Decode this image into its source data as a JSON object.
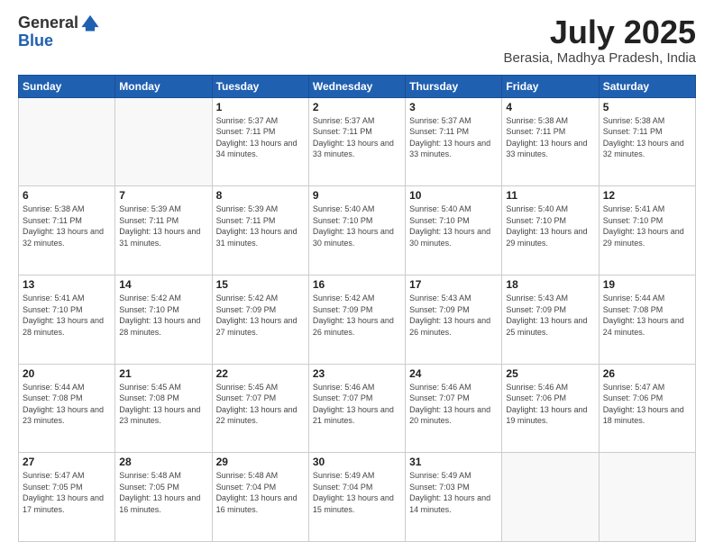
{
  "header": {
    "logo_general": "General",
    "logo_blue": "Blue",
    "title_month": "July 2025",
    "title_location": "Berasia, Madhya Pradesh, India"
  },
  "days_of_week": [
    "Sunday",
    "Monday",
    "Tuesday",
    "Wednesday",
    "Thursday",
    "Friday",
    "Saturday"
  ],
  "weeks": [
    [
      {
        "day": null,
        "info": ""
      },
      {
        "day": null,
        "info": ""
      },
      {
        "day": "1",
        "sunrise": "5:37 AM",
        "sunset": "7:11 PM",
        "daylight": "13 hours and 34 minutes."
      },
      {
        "day": "2",
        "sunrise": "5:37 AM",
        "sunset": "7:11 PM",
        "daylight": "13 hours and 33 minutes."
      },
      {
        "day": "3",
        "sunrise": "5:37 AM",
        "sunset": "7:11 PM",
        "daylight": "13 hours and 33 minutes."
      },
      {
        "day": "4",
        "sunrise": "5:38 AM",
        "sunset": "7:11 PM",
        "daylight": "13 hours and 33 minutes."
      },
      {
        "day": "5",
        "sunrise": "5:38 AM",
        "sunset": "7:11 PM",
        "daylight": "13 hours and 32 minutes."
      }
    ],
    [
      {
        "day": "6",
        "sunrise": "5:38 AM",
        "sunset": "7:11 PM",
        "daylight": "13 hours and 32 minutes."
      },
      {
        "day": "7",
        "sunrise": "5:39 AM",
        "sunset": "7:11 PM",
        "daylight": "13 hours and 31 minutes."
      },
      {
        "day": "8",
        "sunrise": "5:39 AM",
        "sunset": "7:11 PM",
        "daylight": "13 hours and 31 minutes."
      },
      {
        "day": "9",
        "sunrise": "5:40 AM",
        "sunset": "7:10 PM",
        "daylight": "13 hours and 30 minutes."
      },
      {
        "day": "10",
        "sunrise": "5:40 AM",
        "sunset": "7:10 PM",
        "daylight": "13 hours and 30 minutes."
      },
      {
        "day": "11",
        "sunrise": "5:40 AM",
        "sunset": "7:10 PM",
        "daylight": "13 hours and 29 minutes."
      },
      {
        "day": "12",
        "sunrise": "5:41 AM",
        "sunset": "7:10 PM",
        "daylight": "13 hours and 29 minutes."
      }
    ],
    [
      {
        "day": "13",
        "sunrise": "5:41 AM",
        "sunset": "7:10 PM",
        "daylight": "13 hours and 28 minutes."
      },
      {
        "day": "14",
        "sunrise": "5:42 AM",
        "sunset": "7:10 PM",
        "daylight": "13 hours and 28 minutes."
      },
      {
        "day": "15",
        "sunrise": "5:42 AM",
        "sunset": "7:09 PM",
        "daylight": "13 hours and 27 minutes."
      },
      {
        "day": "16",
        "sunrise": "5:42 AM",
        "sunset": "7:09 PM",
        "daylight": "13 hours and 26 minutes."
      },
      {
        "day": "17",
        "sunrise": "5:43 AM",
        "sunset": "7:09 PM",
        "daylight": "13 hours and 26 minutes."
      },
      {
        "day": "18",
        "sunrise": "5:43 AM",
        "sunset": "7:09 PM",
        "daylight": "13 hours and 25 minutes."
      },
      {
        "day": "19",
        "sunrise": "5:44 AM",
        "sunset": "7:08 PM",
        "daylight": "13 hours and 24 minutes."
      }
    ],
    [
      {
        "day": "20",
        "sunrise": "5:44 AM",
        "sunset": "7:08 PM",
        "daylight": "13 hours and 23 minutes."
      },
      {
        "day": "21",
        "sunrise": "5:45 AM",
        "sunset": "7:08 PM",
        "daylight": "13 hours and 23 minutes."
      },
      {
        "day": "22",
        "sunrise": "5:45 AM",
        "sunset": "7:07 PM",
        "daylight": "13 hours and 22 minutes."
      },
      {
        "day": "23",
        "sunrise": "5:46 AM",
        "sunset": "7:07 PM",
        "daylight": "13 hours and 21 minutes."
      },
      {
        "day": "24",
        "sunrise": "5:46 AM",
        "sunset": "7:07 PM",
        "daylight": "13 hours and 20 minutes."
      },
      {
        "day": "25",
        "sunrise": "5:46 AM",
        "sunset": "7:06 PM",
        "daylight": "13 hours and 19 minutes."
      },
      {
        "day": "26",
        "sunrise": "5:47 AM",
        "sunset": "7:06 PM",
        "daylight": "13 hours and 18 minutes."
      }
    ],
    [
      {
        "day": "27",
        "sunrise": "5:47 AM",
        "sunset": "7:05 PM",
        "daylight": "13 hours and 17 minutes."
      },
      {
        "day": "28",
        "sunrise": "5:48 AM",
        "sunset": "7:05 PM",
        "daylight": "13 hours and 16 minutes."
      },
      {
        "day": "29",
        "sunrise": "5:48 AM",
        "sunset": "7:04 PM",
        "daylight": "13 hours and 16 minutes."
      },
      {
        "day": "30",
        "sunrise": "5:49 AM",
        "sunset": "7:04 PM",
        "daylight": "13 hours and 15 minutes."
      },
      {
        "day": "31",
        "sunrise": "5:49 AM",
        "sunset": "7:03 PM",
        "daylight": "13 hours and 14 minutes."
      },
      {
        "day": null,
        "info": ""
      },
      {
        "day": null,
        "info": ""
      }
    ]
  ]
}
